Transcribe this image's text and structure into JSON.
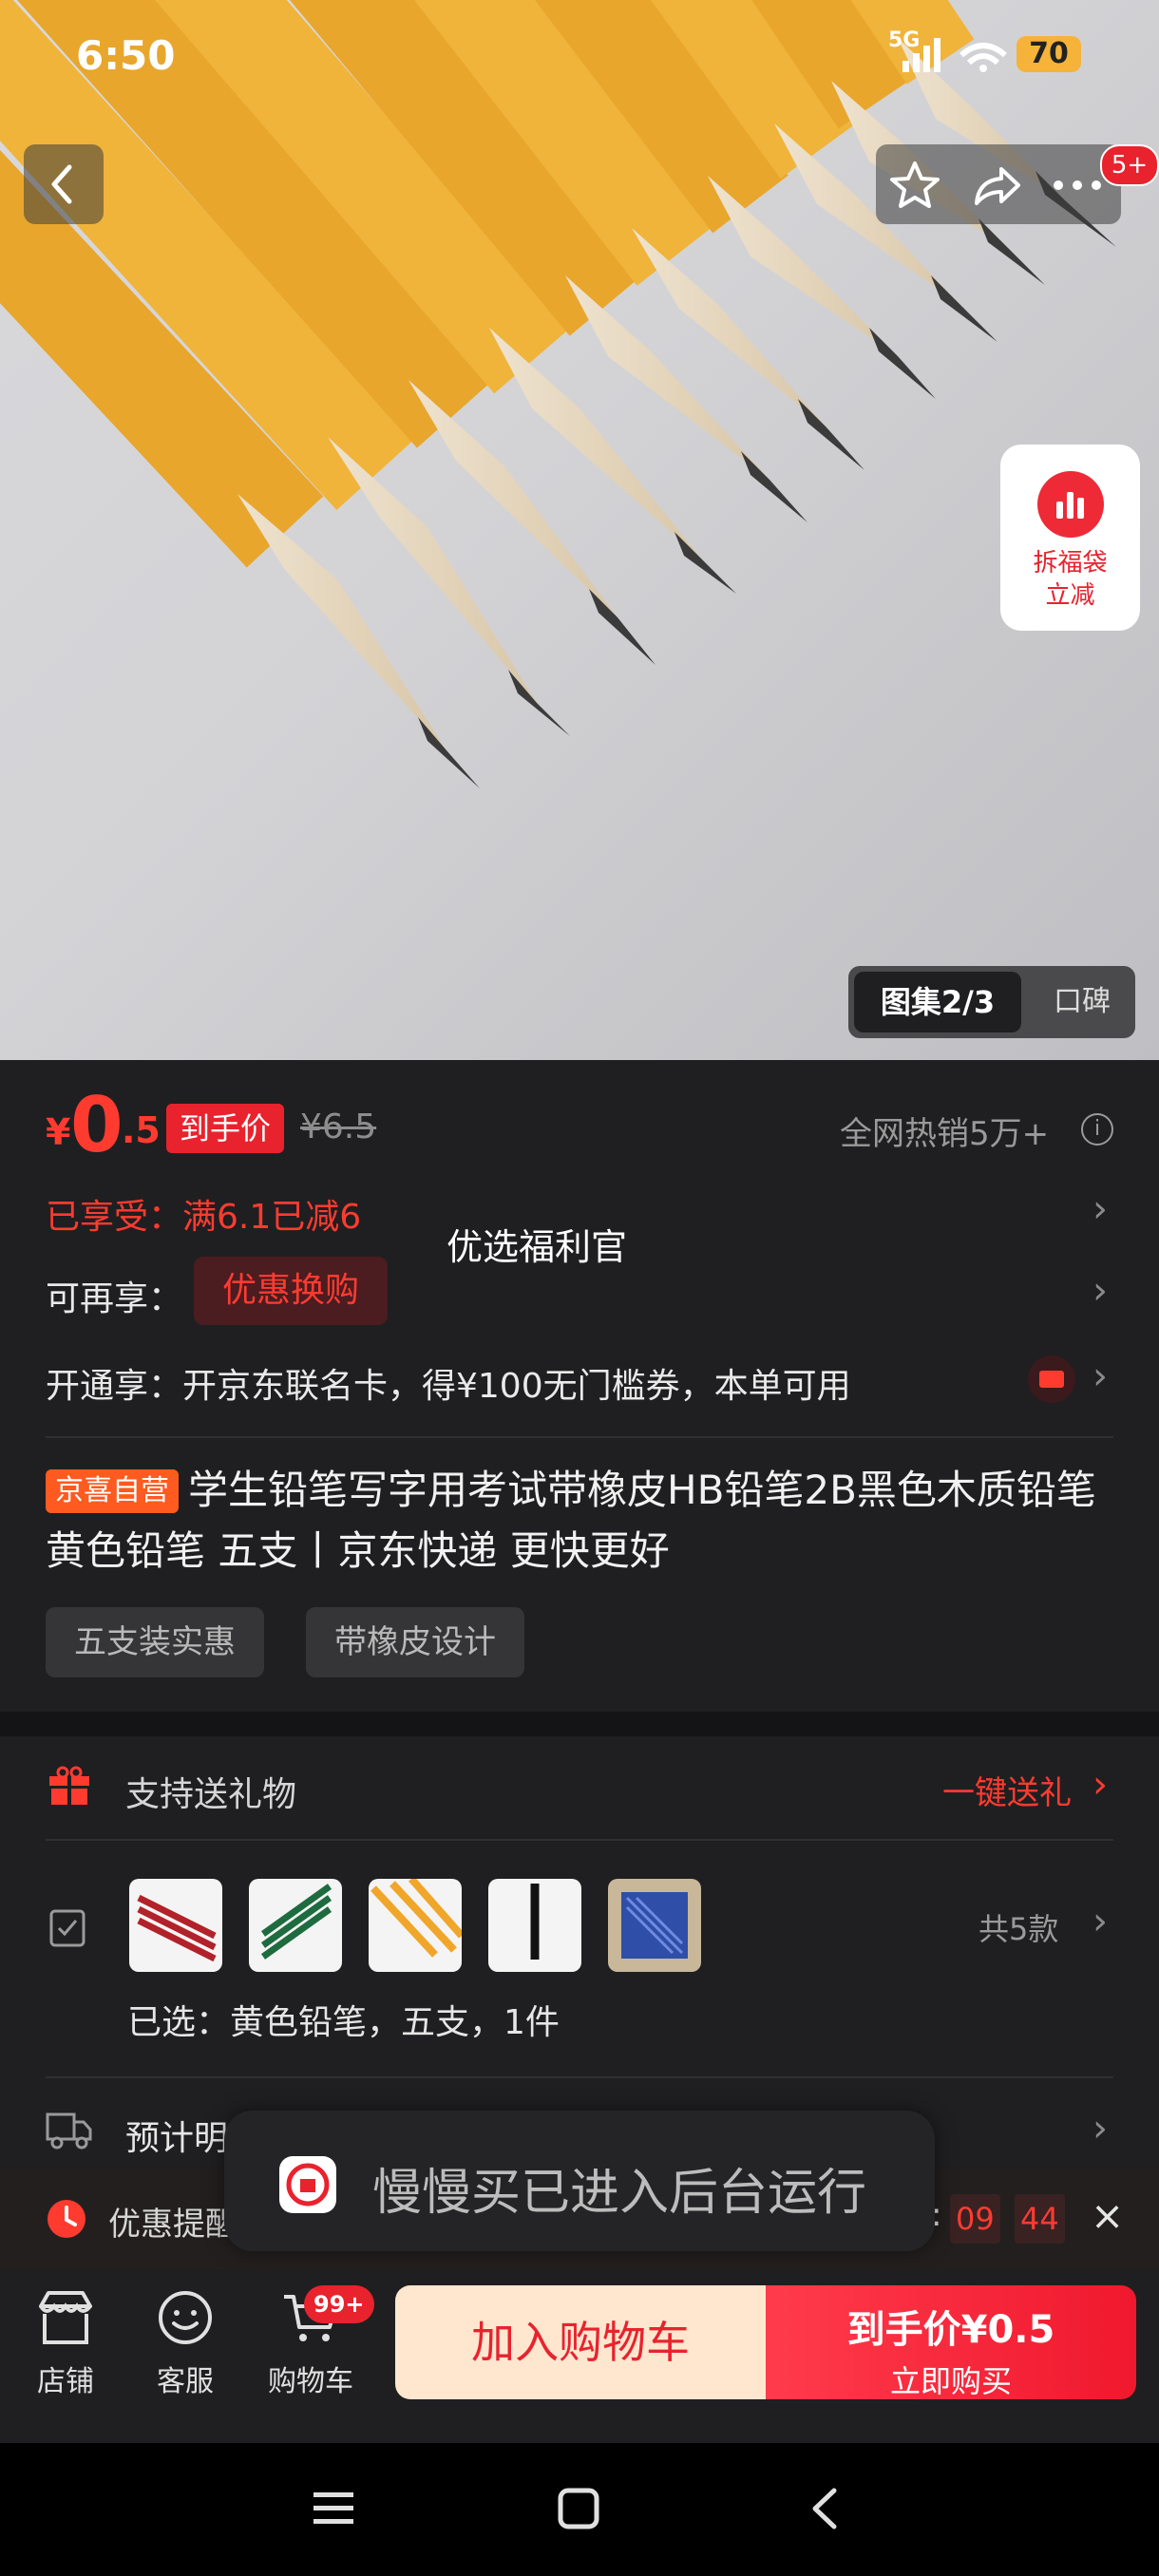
{
  "status_bar": {
    "time": "6:50",
    "network": "5G",
    "battery": "70"
  },
  "top_bar": {
    "notifications_badge": "5+"
  },
  "hero": {
    "floating_promo": {
      "line1": "拆福袋",
      "line2": "立减"
    },
    "gallery_tab": "图集2/3",
    "reviews_tab": "口碑"
  },
  "price": {
    "currency": "¥",
    "integer": "0",
    "decimal": ".5",
    "label": "到手价",
    "original": "¥6.5",
    "hot_sales": "全网热销5万+"
  },
  "promotions": {
    "enjoyed": "已享受：满6.1已减6",
    "more_label": "可再享：",
    "more_button": "优惠换购",
    "welfare_tip": "优选福利官",
    "card_offer": "开通享：开京东联名卡，得¥100无门槛券，本单可用"
  },
  "product": {
    "tag": "京喜自营",
    "title": "学生铅笔写字用考试带橡皮HB铅笔2B黑色木质铅笔 黄色铅笔 五支丨京东快递 更快更好",
    "chips": [
      "五支装实惠",
      "带橡皮设计"
    ]
  },
  "gift": {
    "label": "支持送礼物",
    "link": "一键送礼"
  },
  "variants": {
    "total": "共5款",
    "selected": "已选：黄色铅笔，五支，1件"
  },
  "delivery": {
    "label": "预计明"
  },
  "reminder": {
    "label": "优惠提醒",
    "cd_prefix": ":",
    "min": "09",
    "sep": ":",
    "sec": "44"
  },
  "toast": {
    "text": "慢慢买已进入后台运行"
  },
  "action_bar": {
    "store": "店铺",
    "service": "客服",
    "cart": "购物车",
    "cart_badge": "99+",
    "add_cart": "加入购物车",
    "buy_line1": "到手价¥0.5",
    "buy_line2": "立即购买"
  },
  "colors": {
    "accent": "#e8232e",
    "background": "#1f1f21"
  }
}
